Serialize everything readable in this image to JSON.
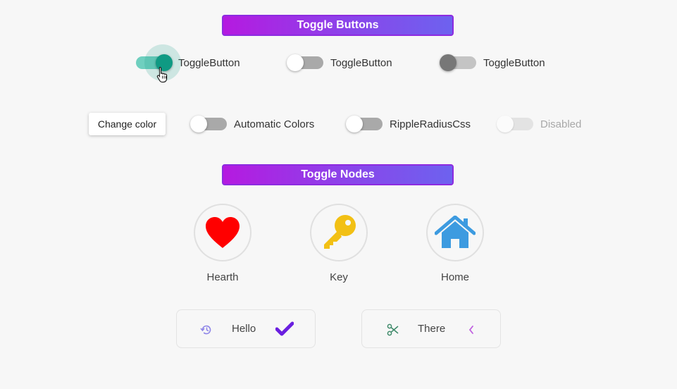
{
  "sections": {
    "toggle_buttons": "Toggle Buttons",
    "toggle_nodes": "Toggle Nodes"
  },
  "row1": [
    {
      "label": "ToggleButton",
      "state": "on"
    },
    {
      "label": "ToggleButton",
      "state": "off"
    },
    {
      "label": "ToggleButton",
      "state": "off-dark"
    }
  ],
  "row2": {
    "change_color": "Change color",
    "toggles": [
      {
        "label": "Automatic Colors",
        "state": "off"
      },
      {
        "label": "RippleRadiusCss",
        "state": "off"
      },
      {
        "label": "Disabled",
        "state": "disabled"
      }
    ]
  },
  "nodes": [
    {
      "label": "Hearth",
      "icon": "heart-icon",
      "color": "#ff0000"
    },
    {
      "label": "Key",
      "icon": "key-icon",
      "color": "#f2c014"
    },
    {
      "label": "Home",
      "icon": "home-icon",
      "color": "#3d9be0"
    }
  ],
  "pills": [
    {
      "text": "Hello",
      "left_icon": "history-icon",
      "right_icon": "check-icon"
    },
    {
      "text": "There",
      "left_icon": "scissors-icon",
      "right_icon": "chevron-left-icon"
    }
  ],
  "colors": {
    "accent_teal": "#0f9a83",
    "header_gradient_start": "#b51ae0",
    "header_gradient_end": "#6d62ef",
    "check_purple": "#6a1fe0"
  }
}
